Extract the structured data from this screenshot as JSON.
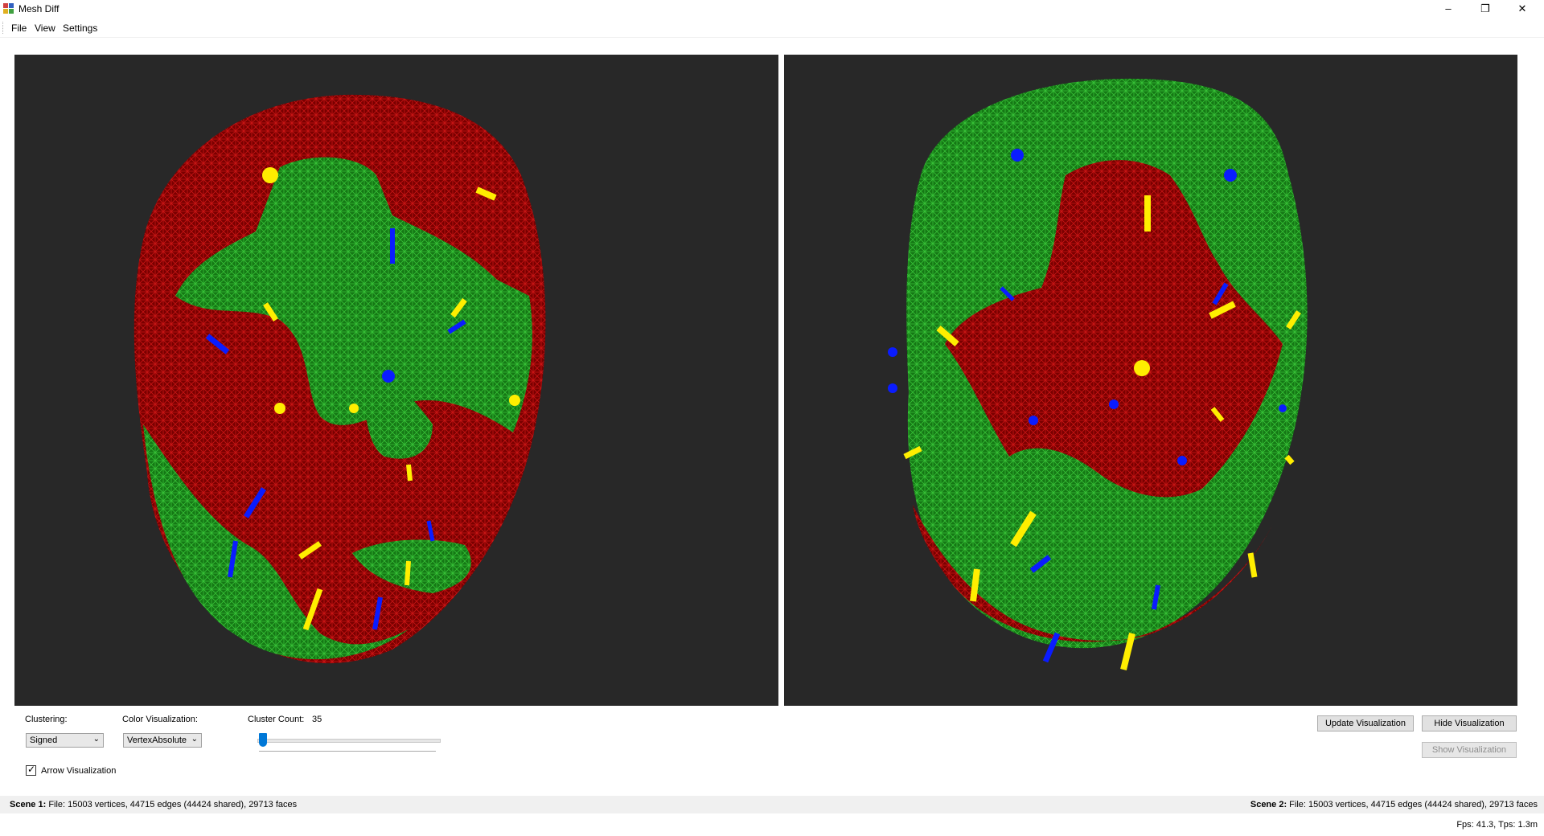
{
  "window": {
    "title": "Mesh Diff",
    "minimize": "–",
    "restore": "❐",
    "close": "✕"
  },
  "menu": {
    "file": "File",
    "view": "View",
    "settings": "Settings"
  },
  "controls": {
    "clustering_label": "Clustering:",
    "clustering_value": "Signed",
    "color_vis_label": "Color Visualization:",
    "color_vis_value": "VertexAbsolute",
    "cluster_count_label": "Cluster Count:",
    "cluster_count_value": "35",
    "arrow_vis_label": "Arrow Visualization",
    "arrow_vis_checked": true
  },
  "buttons": {
    "update": "Update Visualization",
    "hide": "Hide Visualization",
    "show": "Show Visualization"
  },
  "status": {
    "scene1_label": "Scene 1:",
    "scene1_text": "File: 15003 vertices, 44715 edges (44424 shared), 29713 faces",
    "scene2_label": "Scene 2:",
    "scene2_text": "File: 15003 vertices, 44715 edges (44424 shared), 29713 faces",
    "fps": "Fps: 41.3, Tps: 1.3m"
  },
  "colors": {
    "viewport_bg": "#282828",
    "mesh_red": "#a00000",
    "mesh_green": "#1e9a1e",
    "arrow_yellow": "#ffee00",
    "arrow_blue": "#0a1cff",
    "accent": "#0078d7"
  }
}
